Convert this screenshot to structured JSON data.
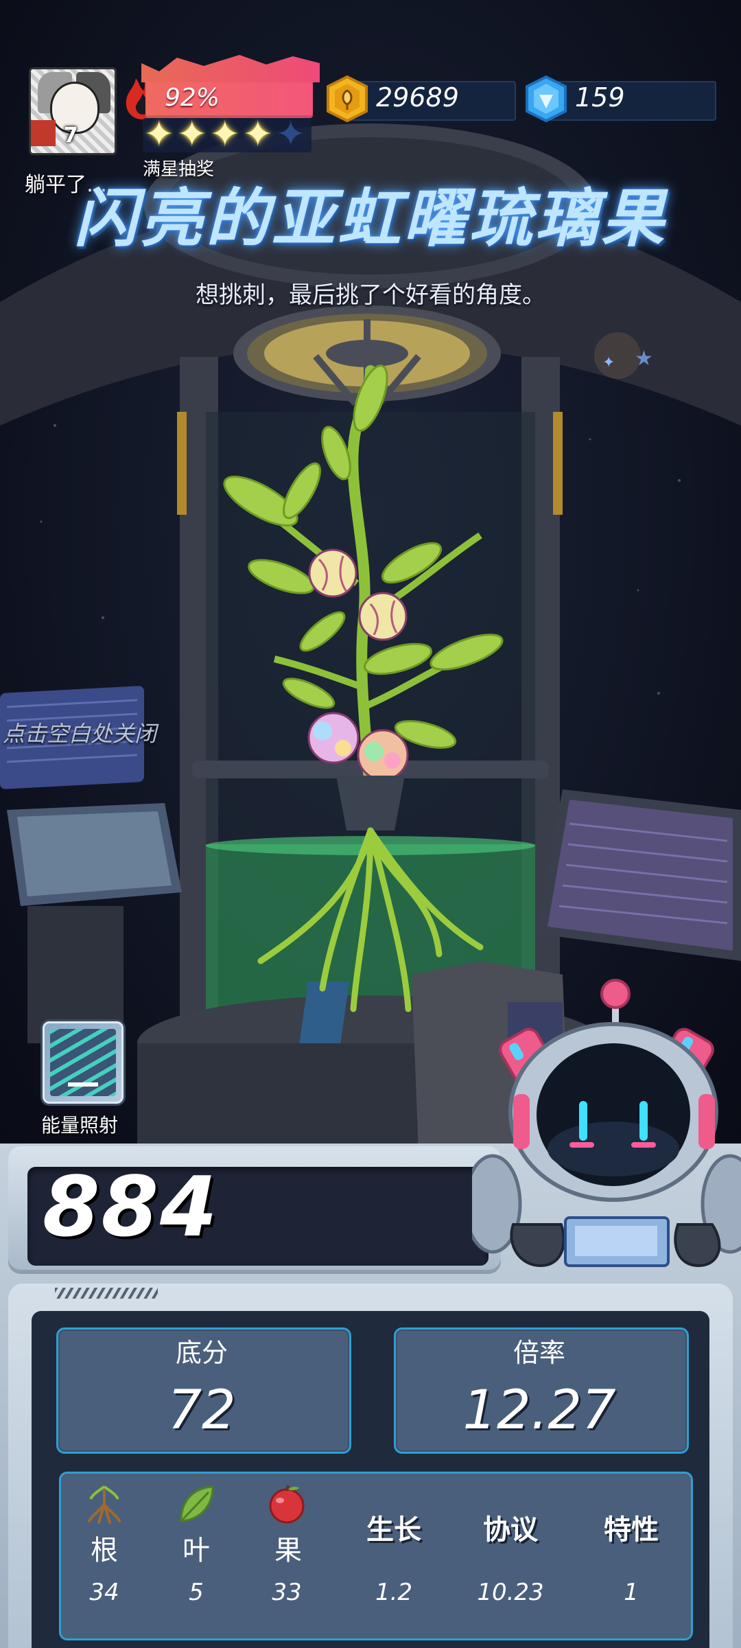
{
  "hud": {
    "level": "7",
    "username": "躺平了…",
    "fire_percent": "92%",
    "fire_value": 0.92,
    "stars_filled": 4,
    "stars_total": 5,
    "lottery_label": "满星抽奖",
    "coins": "29689",
    "gems": "159"
  },
  "item": {
    "title": "闪亮的亚虹曜琉璃果",
    "description": "想挑刺，最后挑了个好看的角度。"
  },
  "hints": {
    "close": "点击空白处关闭",
    "energy_label": "能量照射"
  },
  "score": {
    "total": "884",
    "base_label": "底分",
    "base_value": "72",
    "mult_label": "倍率",
    "mult_value": "12.27"
  },
  "breakdown": [
    {
      "label": "根",
      "value": "34",
      "icon": "root-icon"
    },
    {
      "label": "叶",
      "value": "5",
      "icon": "leaf-icon"
    },
    {
      "label": "果",
      "value": "33",
      "icon": "fruit-icon"
    },
    {
      "label": "生长",
      "value": "1.2"
    },
    {
      "label": "协议",
      "value": "10.23"
    },
    {
      "label": "特性",
      "value": "1"
    }
  ],
  "colors": {
    "fire": "#f3567a",
    "accent_border": "#2f9fd0",
    "title_glow": "#5aaaff",
    "liquid": "#3fd47a"
  }
}
